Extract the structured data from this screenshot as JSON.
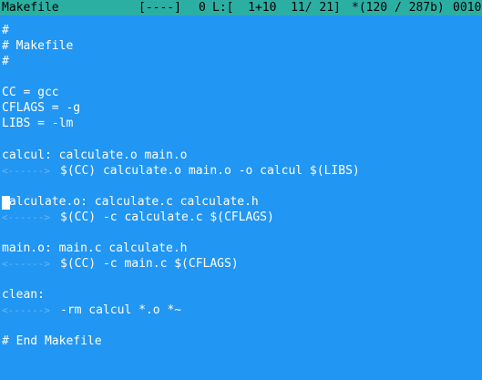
{
  "status_bar": {
    "filename": "Makefile",
    "flags": "[----]",
    "col": "0",
    "line_info": "L:[  1+10  11/ 21]",
    "char_info": "*(120 / 287b)",
    "code": "0010"
  },
  "file": {
    "tab_marker": "<------>",
    "lines": [
      "#",
      "# Makefile",
      "#",
      "",
      "CC = gcc",
      "CFLAGS = -g",
      "LIBS = -lm",
      "",
      "calcul: calculate.o main.o",
      "$(CC) calculate.o main.o -o calcul $(LIBS)",
      "",
      "calculate.o: calculate.c calculate.h",
      "$(CC) -c calculate.c $(CFLAGS)",
      "",
      "main.o: main.c calculate.h",
      "$(CC) -c main.c $(CFLAGS)",
      "",
      "clean:",
      "-rm calcul *.o *~",
      "",
      "# End Makefile"
    ]
  }
}
